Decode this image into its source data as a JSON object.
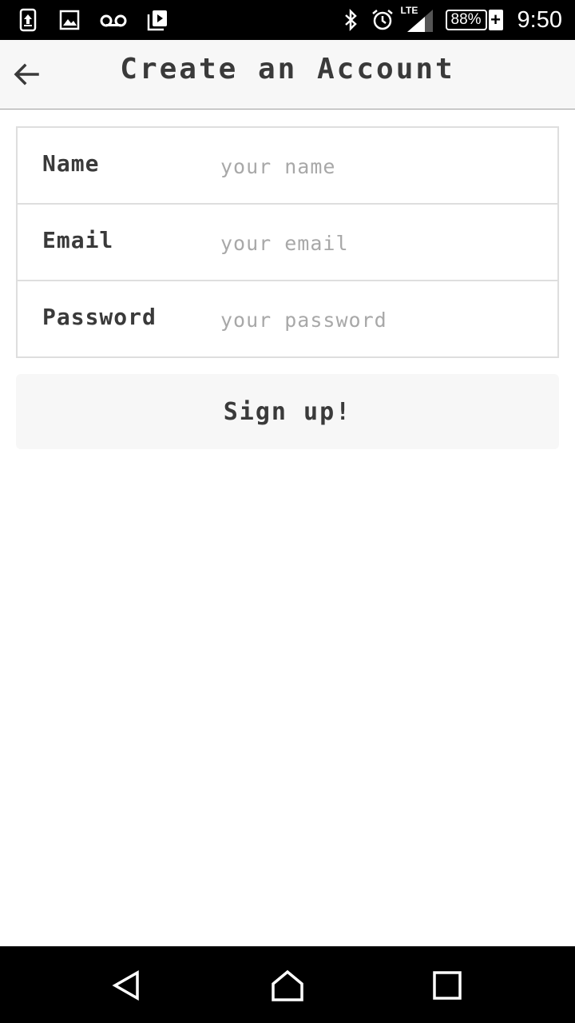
{
  "status_bar": {
    "left_icons": [
      "upload-icon",
      "image-icon",
      "voicemail-icon",
      "media-icon"
    ],
    "right_icons": [
      "bluetooth-icon",
      "alarm-icon",
      "signal-icon"
    ],
    "network_label": "LTE",
    "battery_percent": "88%",
    "battery_charging": "+",
    "time": "9:50"
  },
  "app_bar": {
    "title": "Create an Account",
    "back_icon": "arrow-back-icon"
  },
  "form": {
    "fields": [
      {
        "label": "Name",
        "placeholder": "your name",
        "value": ""
      },
      {
        "label": "Email",
        "placeholder": "your email",
        "value": ""
      },
      {
        "label": "Password",
        "placeholder": "your password",
        "value": ""
      }
    ],
    "submit_label": "Sign up!"
  },
  "nav_bar": {
    "buttons": [
      "back-triangle-icon",
      "home-icon",
      "recents-icon"
    ]
  },
  "colors": {
    "status_bar": "#000000",
    "app_bar": "#f7f7f7",
    "text": "#3a3a3a",
    "placeholder": "#a8a8a8",
    "border": "#dedede"
  }
}
